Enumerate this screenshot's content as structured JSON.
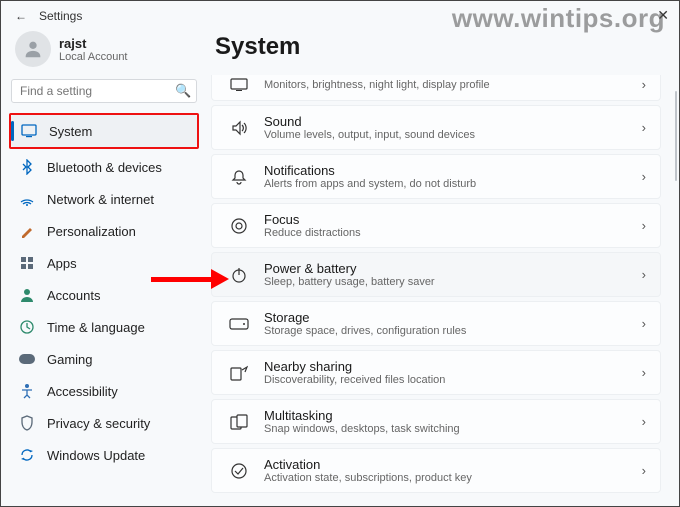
{
  "window": {
    "title": "Settings",
    "close_glyph": "✕",
    "back_glyph": "←"
  },
  "watermark": "www.wintips.org",
  "user": {
    "name": "rajst",
    "subtitle": "Local Account"
  },
  "search": {
    "placeholder": "Find a setting"
  },
  "sidebar": {
    "items": [
      {
        "label": "System",
        "iconColor": "#0067c0",
        "active": true,
        "highlight": true
      },
      {
        "label": "Bluetooth & devices",
        "iconColor": "#0067c0"
      },
      {
        "label": "Network & internet",
        "iconColor": "#0067c0"
      },
      {
        "label": "Personalization",
        "iconColor": "#c06a2d"
      },
      {
        "label": "Apps",
        "iconColor": "#5b6a79"
      },
      {
        "label": "Accounts",
        "iconColor": "#2e8a6c"
      },
      {
        "label": "Time & language",
        "iconColor": "#2e8a6c"
      },
      {
        "label": "Gaming",
        "iconColor": "#5b6a79"
      },
      {
        "label": "Accessibility",
        "iconColor": "#2e6fb5"
      },
      {
        "label": "Privacy & security",
        "iconColor": "#5b6a79"
      },
      {
        "label": "Windows Update",
        "iconColor": "#0067c0"
      }
    ]
  },
  "main": {
    "heading": "System",
    "cards": [
      {
        "title": "Display",
        "subtitle": "Monitors, brightness, night light, display profile",
        "cutTop": true
      },
      {
        "title": "Sound",
        "subtitle": "Volume levels, output, input, sound devices"
      },
      {
        "title": "Notifications",
        "subtitle": "Alerts from apps and system, do not disturb"
      },
      {
        "title": "Focus",
        "subtitle": "Reduce distractions"
      },
      {
        "title": "Power & battery",
        "subtitle": "Sleep, battery usage, battery saver",
        "arrowTarget": true
      },
      {
        "title": "Storage",
        "subtitle": "Storage space, drives, configuration rules"
      },
      {
        "title": "Nearby sharing",
        "subtitle": "Discoverability, received files location"
      },
      {
        "title": "Multitasking",
        "subtitle": "Snap windows, desktops, task switching"
      },
      {
        "title": "Activation",
        "subtitle": "Activation state, subscriptions, product key"
      }
    ]
  },
  "icons": {
    "Display": "▭",
    "Sound": "🕪",
    "Notifications": "🔔",
    "Focus": "◎",
    "Power & battery": "⏻",
    "Storage": "▭",
    "Nearby sharing": "↪",
    "Multitasking": "❐",
    "Activation": "✓"
  }
}
